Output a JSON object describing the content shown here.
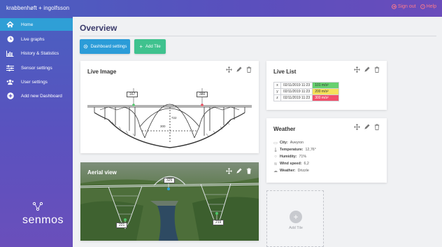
{
  "topbar": {
    "brand": "krabbenhøft + ingolfsson",
    "sign_out": "Sign out",
    "help": "Help"
  },
  "sidebar": {
    "items": [
      {
        "label": "Home",
        "icon": "home-icon"
      },
      {
        "label": "Live graphs",
        "icon": "clock-icon"
      },
      {
        "label": "History & Statistics",
        "icon": "chart-icon"
      },
      {
        "label": "Sensor settings",
        "icon": "sliders-icon"
      },
      {
        "label": "User settings",
        "icon": "users-icon"
      },
      {
        "label": "Add new Dashboard",
        "icon": "plus-circle-icon"
      }
    ],
    "logo_text": "senmos"
  },
  "main": {
    "title": "Overview",
    "dashboard_settings": "Dashboard settings",
    "add_tile": "Add Tile"
  },
  "live_image": {
    "title": "Live Image",
    "sensor_left": "167",
    "sensor_right": "380",
    "drawing_dim_1": "722",
    "drawing_dim_2": "300"
  },
  "aerial": {
    "title": "Aerial view",
    "sensor_top": "325",
    "sensor_left": "221",
    "sensor_right": "219"
  },
  "live_list": {
    "title": "Live List",
    "rows": [
      {
        "axis": "x",
        "time": "02/11/2019 11:23",
        "value": "101 m/s²",
        "color": "#67d06f"
      },
      {
        "axis": "y",
        "time": "02/11/2019 11:23",
        "value": "200 m/s²",
        "color": "#f5e15a"
      },
      {
        "axis": "z",
        "time": "02/11/2019 11:23",
        "value": "300 m/s²",
        "color": "#f2506a"
      }
    ]
  },
  "weather": {
    "title": "Weather",
    "city_label": "City:",
    "city": "Aveyron",
    "temp_label": "Temperature:",
    "temp": "12,76°",
    "humidity_label": "Humidity:",
    "humidity": "71%",
    "wind_label": "Wind speed:",
    "wind": "6,2",
    "cond_label": "Weather:",
    "cond": "Drizzle"
  },
  "add_tile_card": {
    "label": "Add Tile"
  },
  "colors": {
    "accent_blue": "#2b9cd8",
    "accent_green": "#3fc28e",
    "sign_out": "#ff7a8a"
  }
}
